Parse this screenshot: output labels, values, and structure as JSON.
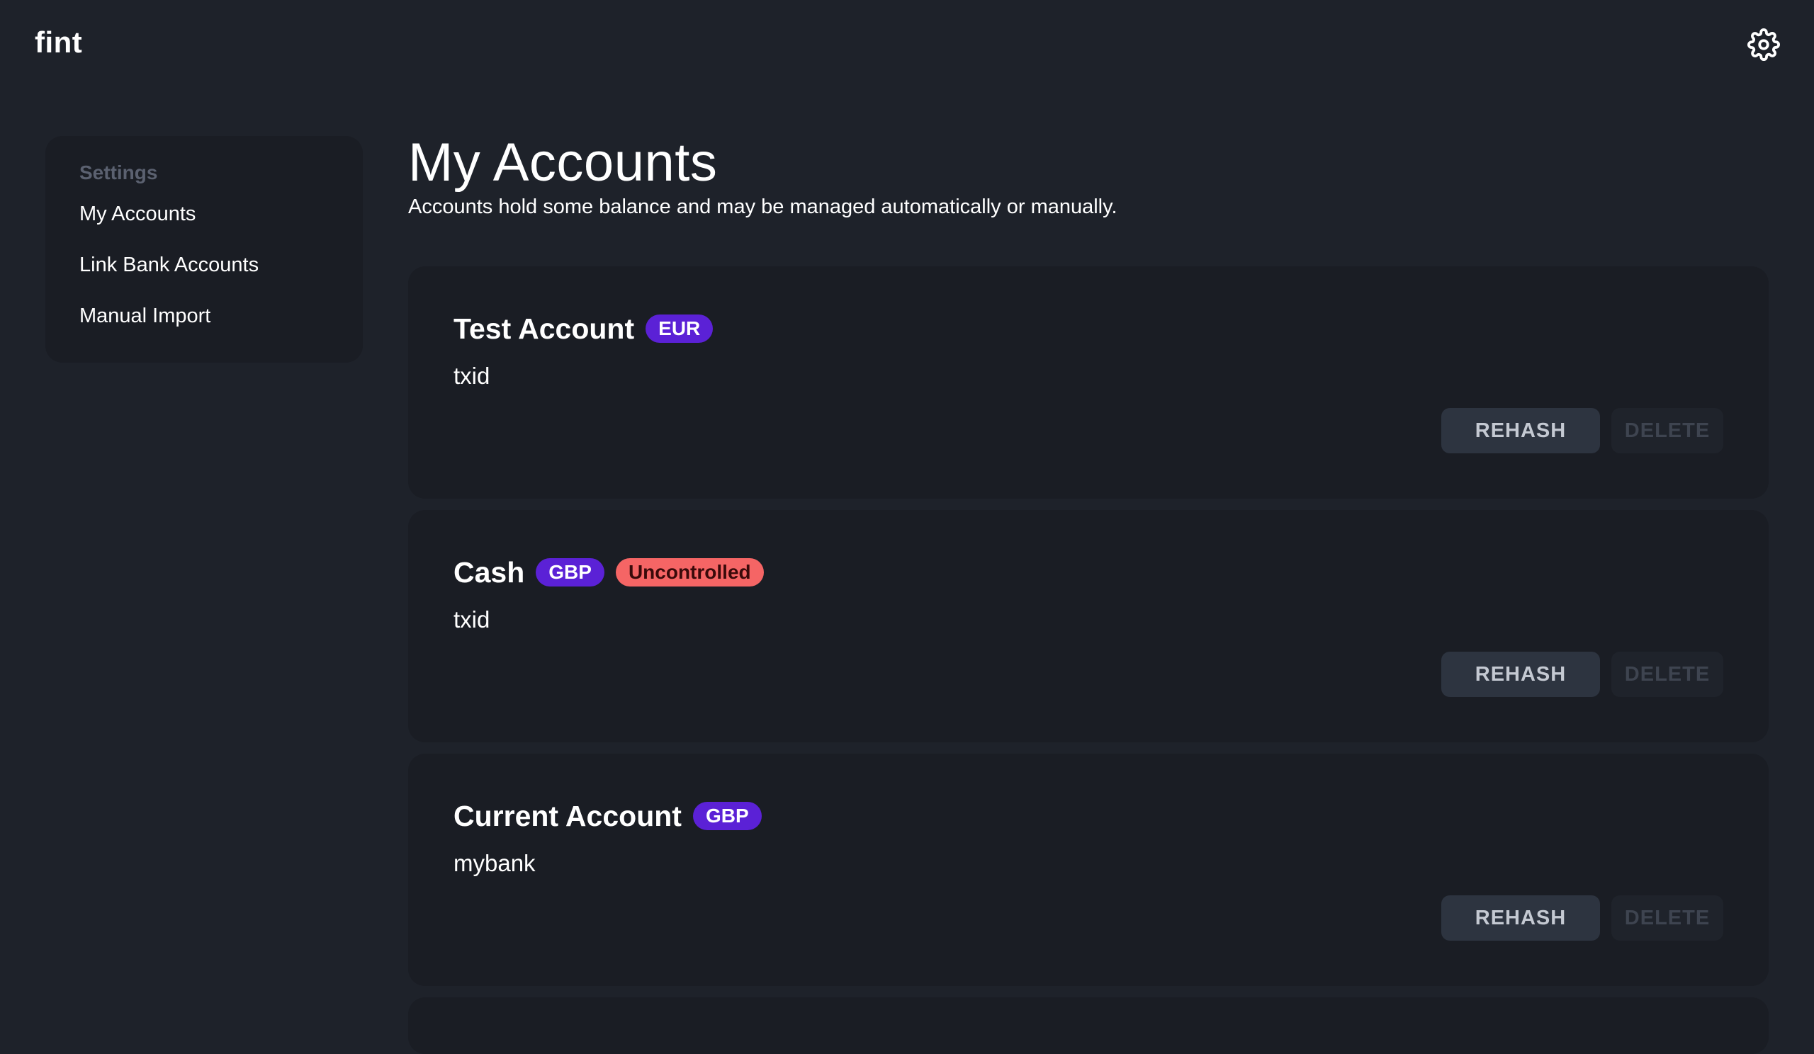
{
  "app": {
    "brand": "fint",
    "settings_icon": "gear-icon"
  },
  "sidebar": {
    "heading": "Settings",
    "items": [
      {
        "label": "My Accounts"
      },
      {
        "label": "Link Bank Accounts"
      },
      {
        "label": "Manual Import"
      }
    ]
  },
  "main": {
    "title": "My Accounts",
    "subtitle": "Accounts hold some balance and may be managed automatically or manually."
  },
  "accounts": [
    {
      "name": "Test Account",
      "currency": "EUR",
      "status": "",
      "source": "txid",
      "rehash_label": "REHASH",
      "delete_label": "DELETE"
    },
    {
      "name": "Cash",
      "currency": "GBP",
      "status": "Uncontrolled",
      "source": "txid",
      "rehash_label": "REHASH",
      "delete_label": "DELETE"
    },
    {
      "name": "Current Account",
      "currency": "GBP",
      "status": "",
      "source": "mybank",
      "rehash_label": "REHASH",
      "delete_label": "DELETE"
    }
  ],
  "colors": {
    "background": "#1e222a",
    "card": "#1a1d24",
    "currency_badge": "#5b21d6",
    "uncontrolled_badge": "#f56565",
    "rehash_button": "#2d3440"
  }
}
